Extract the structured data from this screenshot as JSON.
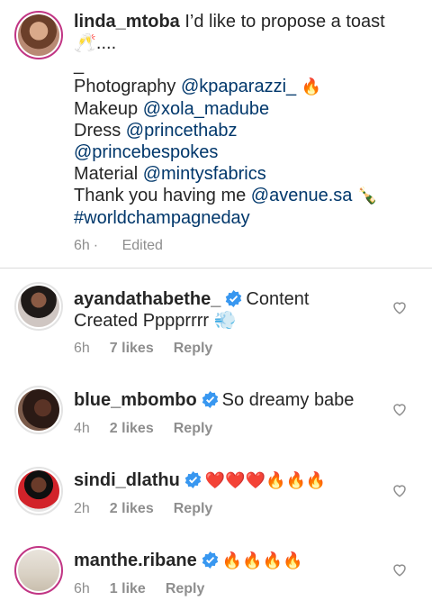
{
  "caption": {
    "username": "linda_mtoba",
    "lines": [
      {
        "text": "I’d like to propose a toast"
      },
      {
        "text": "🥂...."
      },
      {
        "text": "_"
      },
      {
        "prefix": "Photography ",
        "mention": "@kpaparazzi_",
        "suffix": " 🔥"
      },
      {
        "prefix": "Makeup ",
        "mention": "@xola_madube",
        "suffix": ""
      },
      {
        "prefix": "Dress ",
        "mention": "@princethabz",
        "suffix": ""
      },
      {
        "prefix": "",
        "mention": "@princebespokes",
        "suffix": ""
      },
      {
        "prefix": "Material ",
        "mention": "@mintysfabrics",
        "suffix": ""
      },
      {
        "prefix": "Thank you having me ",
        "mention": "@avenue.sa",
        "suffix": " 🍾"
      },
      {
        "prefix": "",
        "mention": "#worldchampagneday",
        "suffix": ""
      }
    ],
    "time": "6h",
    "edited": "Edited"
  },
  "comments": [
    {
      "username": "ayandathabethe_",
      "text": "Content Created Pppprrrr 💨",
      "time": "6h",
      "likes": "7 likes",
      "reply": "Reply"
    },
    {
      "username": "blue_mbombo",
      "text": "So dreamy babe",
      "time": "4h",
      "likes": "2 likes",
      "reply": "Reply"
    },
    {
      "username": "sindi_dlathu",
      "text": "❤️❤️❤️🔥🔥🔥",
      "time": "2h",
      "likes": "2 likes",
      "reply": "Reply"
    },
    {
      "username": "manthe.ribane",
      "text": "🔥🔥🔥🔥",
      "time": "6h",
      "likes": "1 like",
      "reply": "Reply"
    }
  ],
  "colors": {
    "text": "#262626",
    "mention": "#00376b",
    "meta": "#8e8e8e",
    "verified": "#3897f0",
    "story_ring": "#c13584"
  }
}
